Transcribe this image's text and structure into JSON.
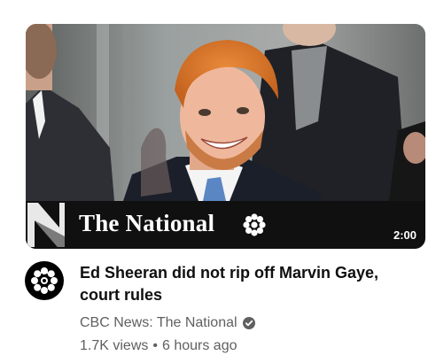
{
  "video": {
    "brand_title": "The National",
    "duration": "2:00",
    "title_line1": "Ed Sheeran did not rip off Marvin Gaye,",
    "title_line2": "court rules",
    "channel": "CBC News: The National",
    "views": "1.7K views",
    "separator": "•",
    "age": "6 hours ago"
  },
  "icons": {
    "channel_avatar": "cbc-gem-icon",
    "verified": "verified-check-icon",
    "banner_logo": "the-national-n-icon",
    "banner_gem": "cbc-gem-icon"
  },
  "colors": {
    "text_primary": "#0f0f0f",
    "text_secondary": "#606060",
    "banner_bg": "#101010"
  }
}
